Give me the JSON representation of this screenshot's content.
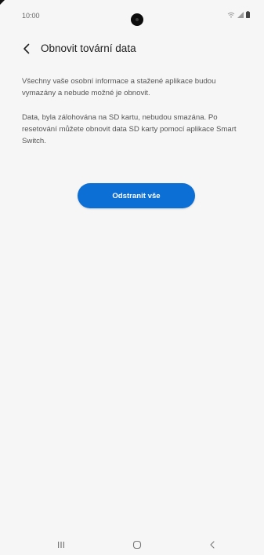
{
  "status_bar": {
    "time": "10:00",
    "icons": [
      "wifi-icon",
      "signal-icon",
      "battery-icon"
    ]
  },
  "header": {
    "back_icon": "chevron-left-icon",
    "title": "Obnovit tovární data"
  },
  "main": {
    "paragraphs": [
      "Všechny vaše osobní informace a stažené aplikace budou vymazány a nebude možné je obnovit.",
      "Data, byla zálohována na SD kartu, nebudou smazána. Po resetování můžete obnovit data SD karty pomocí aplikace Smart Switch."
    ],
    "action_button_label": "Odstranit vše"
  },
  "nav_bar": {
    "icons": [
      "recent-apps-icon",
      "home-icon",
      "back-icon"
    ]
  },
  "colors": {
    "accent": "#0c6fd6",
    "background": "#f6f6f6",
    "text": "#202020",
    "secondary_text": "#555555"
  }
}
